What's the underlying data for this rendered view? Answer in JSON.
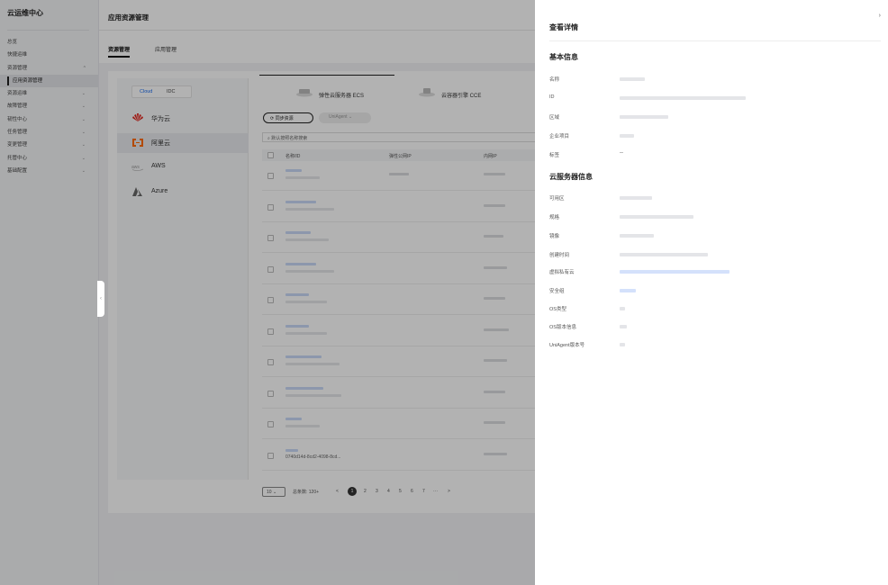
{
  "sidebar": {
    "title": "云运维中心",
    "items": [
      {
        "label": "总览",
        "chevron": ""
      },
      {
        "label": "快捷运维",
        "chevron": ""
      },
      {
        "label": "资源管理",
        "chevron": "^"
      },
      {
        "label": "应用资源管理",
        "chevron": ""
      },
      {
        "label": "资源运维",
        "chevron": "⌄"
      },
      {
        "label": "故障管理",
        "chevron": "⌄"
      },
      {
        "label": "韧性中心",
        "chevron": "⌄"
      },
      {
        "label": "任务管理",
        "chevron": "⌄"
      },
      {
        "label": "变更管理",
        "chevron": "⌄"
      },
      {
        "label": "托管中心",
        "chevron": "⌄"
      },
      {
        "label": "基础配置",
        "chevron": "⌄"
      }
    ],
    "collapse_glyph": "‹"
  },
  "header": {
    "title": "应用资源管理"
  },
  "tabs": [
    "资源管理",
    "应用管理"
  ],
  "cloud_switch": {
    "cloud": "Cloud",
    "idc": "IDC"
  },
  "providers": [
    "华为云",
    "阿里云",
    "AWS",
    "Azure"
  ],
  "resource_tabs": [
    "弹性云服务器 ECS",
    "云容器引擎 CCE"
  ],
  "actions": {
    "sync": "同步资源",
    "uniagent": "UniAgent"
  },
  "search": {
    "placeholder": "默认按照名称搜索"
  },
  "table": {
    "columns": [
      "名称/ID",
      "弹性公网IP",
      "内网IP"
    ],
    "last_row_id": "0740d14d-8cd2-4098-8cd..."
  },
  "pager": {
    "page_size": "10",
    "total": "总条数: 120+",
    "prev": "<",
    "pages": [
      "1",
      "2",
      "3",
      "4",
      "5",
      "6",
      "7"
    ],
    "ellipsis": "···",
    "next": ">"
  },
  "drawer": {
    "title": "查看详情",
    "close_glyph": "›",
    "basic_section": "基本信息",
    "basic_fields": [
      "名称",
      "ID",
      "区域",
      "企业项目",
      "标签"
    ],
    "tags_value": "--",
    "server_section": "云服务器信息",
    "server_fields": [
      "可用区",
      "规格",
      "镜像",
      "创建时间",
      "虚拟私有云",
      "安全组",
      "OS类型",
      "OS版本信息",
      "UniAgent版本号"
    ]
  },
  "colors": {
    "accent": "#1a6cf0",
    "huawei": "#e2231a",
    "aliyun": "#ff6a00",
    "overlay": "rgba(0,0,0,0.30)"
  }
}
